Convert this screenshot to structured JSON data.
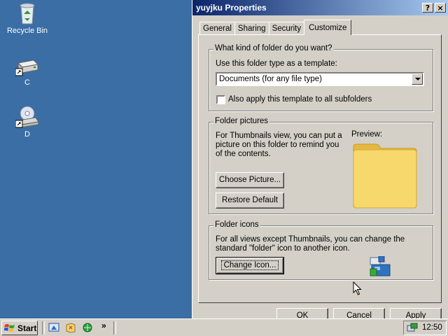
{
  "desktop": {
    "icons": [
      {
        "label": "Recycle Bin"
      },
      {
        "label": "C"
      },
      {
        "label": "D"
      }
    ]
  },
  "window": {
    "title": "yuyjku Properties",
    "help_button": "?",
    "close_button": "×",
    "tabs": [
      "General",
      "Sharing",
      "Security",
      "Customize"
    ],
    "active_tab": "Customize",
    "folder_type_group": {
      "title": "What kind of folder do you want?",
      "template_label": "Use this folder type as a template:",
      "template_value": "Documents (for any file type)",
      "subfolders_label": "Also apply this template to all subfolders",
      "subfolders_checked": false
    },
    "folder_pictures_group": {
      "title": "Folder pictures",
      "description": "For Thumbnails view, you can put a picture on this folder to remind you of the contents.",
      "preview_label": "Preview:",
      "choose_picture_button": "Choose Picture...",
      "restore_default_button": "Restore Default"
    },
    "folder_icons_group": {
      "title": "Folder icons",
      "description": "For all views except Thumbnails, you can change the standard \"folder\" icon to another icon.",
      "change_icon_button": "Change Icon..."
    },
    "footer_buttons": [
      "OK",
      "Cancel",
      "Apply"
    ]
  },
  "taskbar": {
    "start_label": "Start",
    "chevron": "»",
    "clock": "12:50"
  },
  "colors": {
    "desktop": "#3a6ea5",
    "title_gradient_start": "#0a246a",
    "title_gradient_end": "#a6caf0",
    "face": "#d4d0c8",
    "folder_yellow": "#f5d469"
  }
}
